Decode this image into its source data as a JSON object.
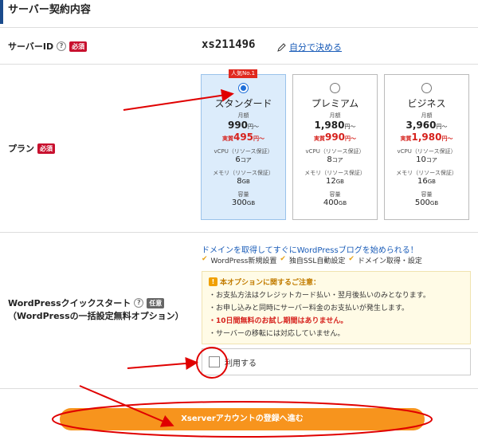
{
  "section": {
    "title": "サーバー契約内容"
  },
  "server_id": {
    "label": "サーバーID",
    "help": "?",
    "required": "必須",
    "value": "xs211496",
    "decide_link": "自分で決める"
  },
  "plan": {
    "label": "プラン",
    "required": "必須",
    "popular_badge": "人気No.1",
    "monthly_label": "月額",
    "real_label": "実質",
    "cpu_label": "vCPU（リソース保証）",
    "mem_label": "メモリ（リソース保証）",
    "disk_label": "容量",
    "items": [
      {
        "name": "スタンダード",
        "price": "990",
        "price_unit": "円～",
        "real": "495",
        "real_unit": "円～",
        "cpu": "6",
        "cpu_unit": "コア",
        "mem": "8",
        "mem_unit": "GB",
        "disk": "300",
        "disk_unit": "GB"
      },
      {
        "name": "プレミアム",
        "price": "1,980",
        "price_unit": "円～",
        "real": "990",
        "real_unit": "円～",
        "cpu": "8",
        "cpu_unit": "コア",
        "mem": "12",
        "mem_unit": "GB",
        "disk": "400",
        "disk_unit": "GB"
      },
      {
        "name": "ビジネス",
        "price": "3,960",
        "price_unit": "円～",
        "real": "1,980",
        "real_unit": "円～",
        "cpu": "10",
        "cpu_unit": "コア",
        "mem": "16",
        "mem_unit": "GB",
        "disk": "500",
        "disk_unit": "GB"
      }
    ],
    "selected": 0
  },
  "wp": {
    "label_line1": "WordPressクイックスタート",
    "label_line2": "（WordPressの一括設定無料オプション）",
    "help": "?",
    "optional": "任意",
    "intro": "ドメインを取得してすぐにWordPressブログを始められる！",
    "features": [
      "WordPress新規設置",
      "独自SSL自動設定",
      "ドメイン取得・設定"
    ],
    "notice_icon": "!",
    "notice_title": "本オプションに関するご注意：",
    "notice_items": [
      "お支払方法はクレジットカード払い・翌月後払いのみとなります。",
      "お申し込みと同時にサーバー料金のお支払いが発生します。",
      "10日間無料のお試し期間はありません。",
      "サーバーの移転には対応していません。"
    ],
    "use_label": "利用する"
  },
  "cta": {
    "label": "Xserverアカウントの登録へ進む"
  },
  "colors": {
    "accent": "#1e6fd9",
    "cta": "#f7941d",
    "required": "#c8102e",
    "annotation": "#e00000"
  }
}
